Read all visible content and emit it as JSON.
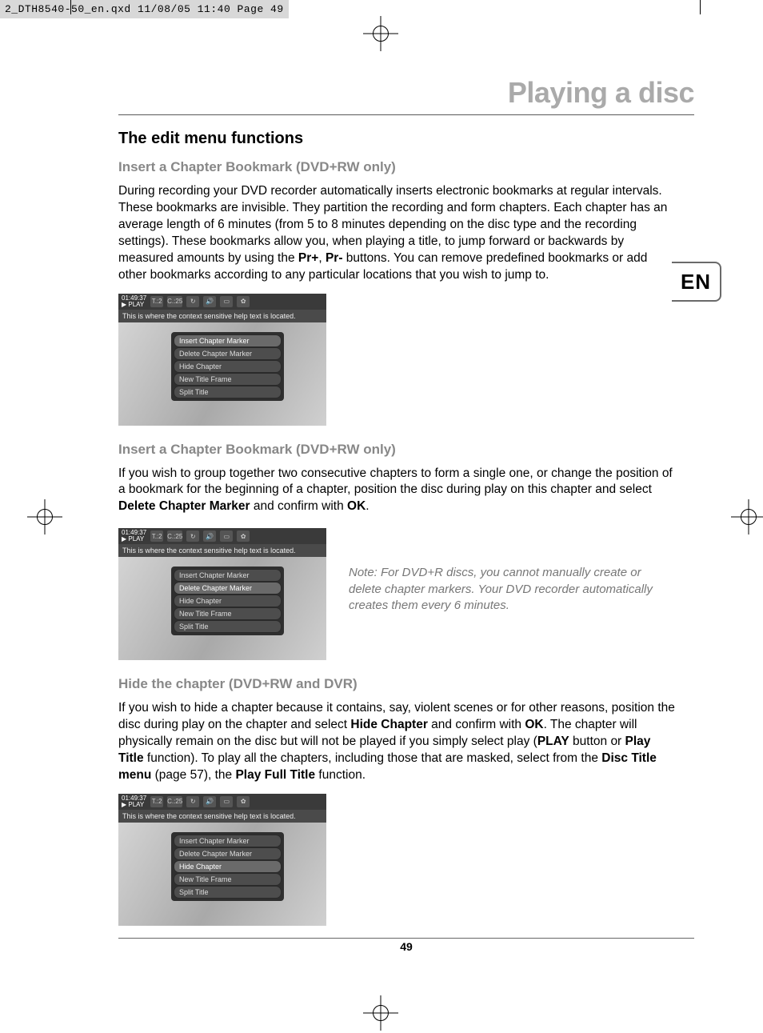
{
  "print_header": "2_DTH8540-50_en.qxd  11/08/05  11:40  Page 49",
  "lang_tab": "EN",
  "page_title": "Playing a disc",
  "page_number": "49",
  "section_title": "The edit menu functions",
  "sub1_title": "Insert a Chapter Bookmark (DVD+RW only)",
  "sub1_body_pre": "During recording your DVD recorder automatically inserts electronic bookmarks at regular intervals. These bookmarks are invisible. They partition the recording and form chapters. Each chapter has an average length of 6 minutes (from 5 to 8 minutes depending on the disc type and the recording settings). These bookmarks allow you, when playing a title, to jump forward or backwards by measured amounts by using the ",
  "sub1_bold_prplus": "Pr+",
  "sub1_mid": ", ",
  "sub1_bold_prminus": "Pr-",
  "sub1_body_post": " buttons. You can remove predefined bookmarks or add other bookmarks according to any particular locations that you wish to jump to.",
  "sub2_title": "Insert a Chapter Bookmark (DVD+RW only)",
  "sub2_body_pre": "If you wish to group together two consecutive chapters to form a single one, or change the position of a bookmark for the beginning of a chapter, position the disc during play on this chapter and select ",
  "sub2_bold_delete": "Delete Chapter Marker",
  "sub2_mid": " and confirm with ",
  "sub2_bold_ok": "OK",
  "sub2_post": ".",
  "note_text": "Note: For DVD+R discs, you cannot manually create or delete chapter markers. Your DVD recorder automatically creates them every 6 minutes.",
  "sub3_title": "Hide the chapter (DVD+RW and DVR)",
  "sub3_body_pre": "If you wish to hide a chapter because it contains, say, violent scenes or for other reasons, position the disc during play on the chapter and select ",
  "sub3_bold_hide": "Hide Chapter",
  "sub3_mid1": " and confirm with ",
  "sub3_bold_ok": "OK",
  "sub3_mid2": ". The chapter will physically remain on the disc but will not be played if you simply select play (",
  "sub3_bold_play": "PLAY",
  "sub3_mid3": " button or ",
  "sub3_bold_playtitle": "Play Title",
  "sub3_mid4": " function). To play all the chapters, including those that are masked, select from the ",
  "sub3_bold_disctitle": "Disc Title menu",
  "sub3_mid5": " (page 57), the ",
  "sub3_bold_playfull": "Play Full Title",
  "sub3_post": " function.",
  "menu": {
    "time": "01:49:37",
    "play": "▶ PLAY",
    "t_label": "T.:2",
    "c_label": "C.:25",
    "help": "This is where the context sensitive help text is located.",
    "items": {
      "0": "Insert Chapter Marker",
      "1": "Delete Chapter Marker",
      "2": "Hide Chapter",
      "3": "New Title Frame",
      "4": "Split Title"
    }
  }
}
